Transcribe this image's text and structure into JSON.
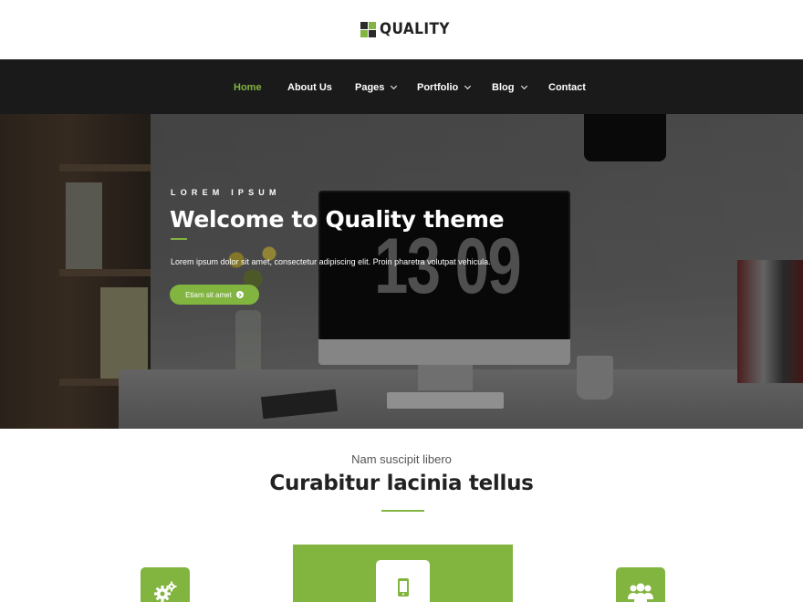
{
  "brand": {
    "name": "QUALITY",
    "colors": {
      "accent": "#82b440",
      "nav_bg": "#1a1a1a"
    }
  },
  "nav": {
    "items": [
      {
        "label": "Home",
        "active": true,
        "dropdown": false
      },
      {
        "label": "About Us",
        "active": false,
        "dropdown": false
      },
      {
        "label": "Pages",
        "active": false,
        "dropdown": true
      },
      {
        "label": "Portfolio",
        "active": false,
        "dropdown": true
      },
      {
        "label": "Blog",
        "active": false,
        "dropdown": true
      },
      {
        "label": "Contact",
        "active": false,
        "dropdown": false
      }
    ]
  },
  "hero": {
    "kicker": "LOREM IPSUM",
    "title": "Welcome to Quality theme",
    "description": "Lorem ipsum dolor sit amet, consectetur adipiscing elit. Proin pharetra volutpat vehicula.",
    "button_label": "Etiam sit amet",
    "clock_display": "13 09"
  },
  "services": {
    "subtitle": "Nam suscipit libero",
    "title_prefix": "Curabitur ",
    "title_bold": "lacinia",
    "title_suffix": " tellus",
    "icons": [
      "gears-icon",
      "mobile-phone-icon",
      "users-icon"
    ]
  }
}
